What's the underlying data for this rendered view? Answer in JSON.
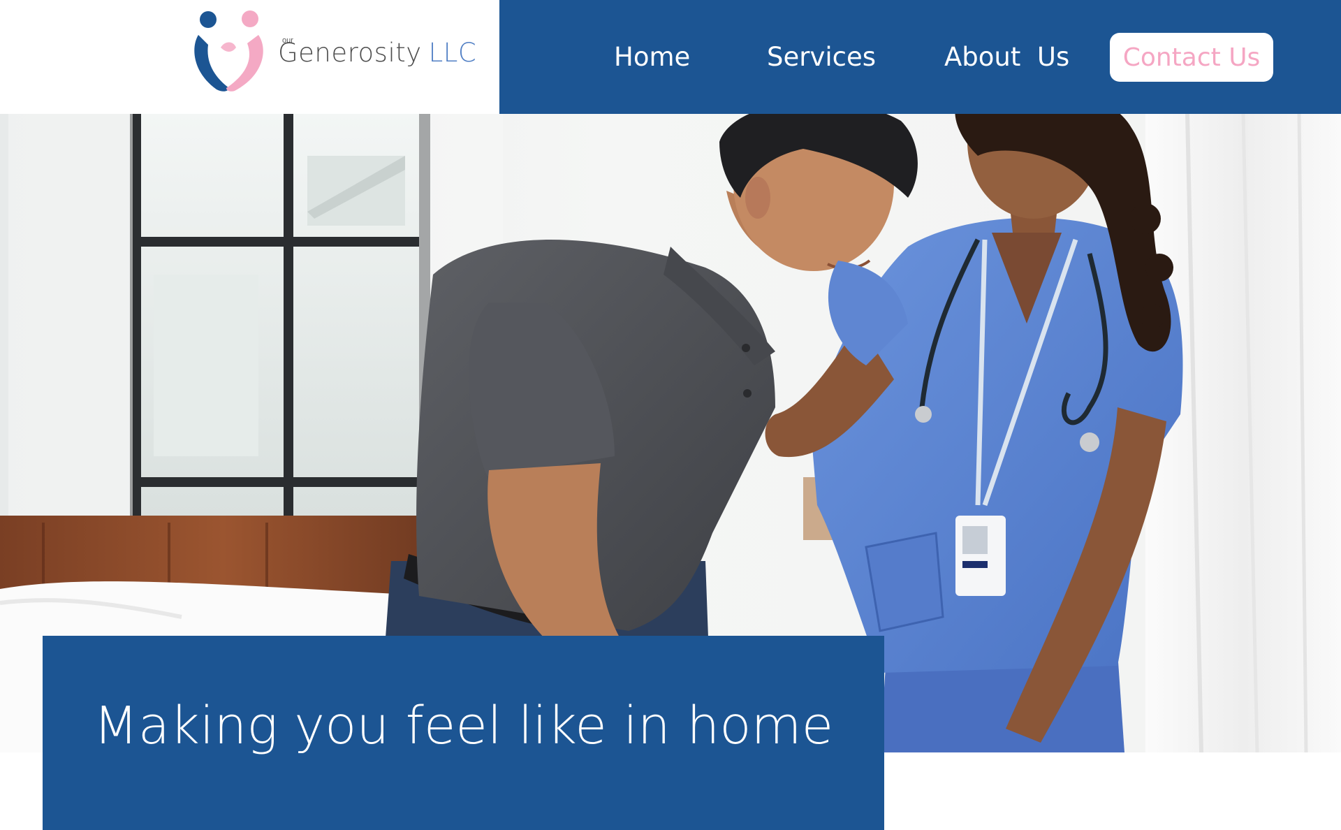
{
  "brand": {
    "small_prefix": "our",
    "name": "Generosity",
    "suffix": "LLC",
    "colors": {
      "navy": "#1c5593",
      "pink": "#f5a6c3",
      "text_gray": "#4d4d4d",
      "suffix_blue": "#4f7ec4"
    }
  },
  "nav": {
    "items": [
      {
        "label": "Home",
        "icon": null
      },
      {
        "label": "Services",
        "icon": null
      },
      {
        "label": "About  Us",
        "icon": null
      }
    ],
    "cta_label": "Contact Us"
  },
  "hero": {
    "image_alt": "Nurse helping an older man get up from a bed",
    "tagline": "Making you feel like in home"
  }
}
